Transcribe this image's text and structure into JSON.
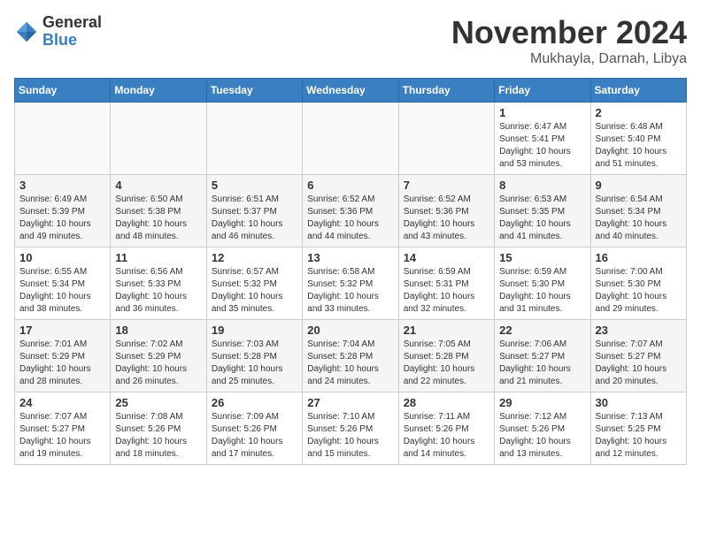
{
  "header": {
    "logo_general": "General",
    "logo_blue": "Blue",
    "month": "November 2024",
    "location": "Mukhayla, Darnah, Libya"
  },
  "days_of_week": [
    "Sunday",
    "Monday",
    "Tuesday",
    "Wednesday",
    "Thursday",
    "Friday",
    "Saturday"
  ],
  "weeks": [
    [
      {
        "day": "",
        "info": ""
      },
      {
        "day": "",
        "info": ""
      },
      {
        "day": "",
        "info": ""
      },
      {
        "day": "",
        "info": ""
      },
      {
        "day": "",
        "info": ""
      },
      {
        "day": "1",
        "info": "Sunrise: 6:47 AM\nSunset: 5:41 PM\nDaylight: 10 hours\nand 53 minutes."
      },
      {
        "day": "2",
        "info": "Sunrise: 6:48 AM\nSunset: 5:40 PM\nDaylight: 10 hours\nand 51 minutes."
      }
    ],
    [
      {
        "day": "3",
        "info": "Sunrise: 6:49 AM\nSunset: 5:39 PM\nDaylight: 10 hours\nand 49 minutes."
      },
      {
        "day": "4",
        "info": "Sunrise: 6:50 AM\nSunset: 5:38 PM\nDaylight: 10 hours\nand 48 minutes."
      },
      {
        "day": "5",
        "info": "Sunrise: 6:51 AM\nSunset: 5:37 PM\nDaylight: 10 hours\nand 46 minutes."
      },
      {
        "day": "6",
        "info": "Sunrise: 6:52 AM\nSunset: 5:36 PM\nDaylight: 10 hours\nand 44 minutes."
      },
      {
        "day": "7",
        "info": "Sunrise: 6:52 AM\nSunset: 5:36 PM\nDaylight: 10 hours\nand 43 minutes."
      },
      {
        "day": "8",
        "info": "Sunrise: 6:53 AM\nSunset: 5:35 PM\nDaylight: 10 hours\nand 41 minutes."
      },
      {
        "day": "9",
        "info": "Sunrise: 6:54 AM\nSunset: 5:34 PM\nDaylight: 10 hours\nand 40 minutes."
      }
    ],
    [
      {
        "day": "10",
        "info": "Sunrise: 6:55 AM\nSunset: 5:34 PM\nDaylight: 10 hours\nand 38 minutes."
      },
      {
        "day": "11",
        "info": "Sunrise: 6:56 AM\nSunset: 5:33 PM\nDaylight: 10 hours\nand 36 minutes."
      },
      {
        "day": "12",
        "info": "Sunrise: 6:57 AM\nSunset: 5:32 PM\nDaylight: 10 hours\nand 35 minutes."
      },
      {
        "day": "13",
        "info": "Sunrise: 6:58 AM\nSunset: 5:32 PM\nDaylight: 10 hours\nand 33 minutes."
      },
      {
        "day": "14",
        "info": "Sunrise: 6:59 AM\nSunset: 5:31 PM\nDaylight: 10 hours\nand 32 minutes."
      },
      {
        "day": "15",
        "info": "Sunrise: 6:59 AM\nSunset: 5:30 PM\nDaylight: 10 hours\nand 31 minutes."
      },
      {
        "day": "16",
        "info": "Sunrise: 7:00 AM\nSunset: 5:30 PM\nDaylight: 10 hours\nand 29 minutes."
      }
    ],
    [
      {
        "day": "17",
        "info": "Sunrise: 7:01 AM\nSunset: 5:29 PM\nDaylight: 10 hours\nand 28 minutes."
      },
      {
        "day": "18",
        "info": "Sunrise: 7:02 AM\nSunset: 5:29 PM\nDaylight: 10 hours\nand 26 minutes."
      },
      {
        "day": "19",
        "info": "Sunrise: 7:03 AM\nSunset: 5:28 PM\nDaylight: 10 hours\nand 25 minutes."
      },
      {
        "day": "20",
        "info": "Sunrise: 7:04 AM\nSunset: 5:28 PM\nDaylight: 10 hours\nand 24 minutes."
      },
      {
        "day": "21",
        "info": "Sunrise: 7:05 AM\nSunset: 5:28 PM\nDaylight: 10 hours\nand 22 minutes."
      },
      {
        "day": "22",
        "info": "Sunrise: 7:06 AM\nSunset: 5:27 PM\nDaylight: 10 hours\nand 21 minutes."
      },
      {
        "day": "23",
        "info": "Sunrise: 7:07 AM\nSunset: 5:27 PM\nDaylight: 10 hours\nand 20 minutes."
      }
    ],
    [
      {
        "day": "24",
        "info": "Sunrise: 7:07 AM\nSunset: 5:27 PM\nDaylight: 10 hours\nand 19 minutes."
      },
      {
        "day": "25",
        "info": "Sunrise: 7:08 AM\nSunset: 5:26 PM\nDaylight: 10 hours\nand 18 minutes."
      },
      {
        "day": "26",
        "info": "Sunrise: 7:09 AM\nSunset: 5:26 PM\nDaylight: 10 hours\nand 17 minutes."
      },
      {
        "day": "27",
        "info": "Sunrise: 7:10 AM\nSunset: 5:26 PM\nDaylight: 10 hours\nand 15 minutes."
      },
      {
        "day": "28",
        "info": "Sunrise: 7:11 AM\nSunset: 5:26 PM\nDaylight: 10 hours\nand 14 minutes."
      },
      {
        "day": "29",
        "info": "Sunrise: 7:12 AM\nSunset: 5:26 PM\nDaylight: 10 hours\nand 13 minutes."
      },
      {
        "day": "30",
        "info": "Sunrise: 7:13 AM\nSunset: 5:25 PM\nDaylight: 10 hours\nand 12 minutes."
      }
    ]
  ]
}
